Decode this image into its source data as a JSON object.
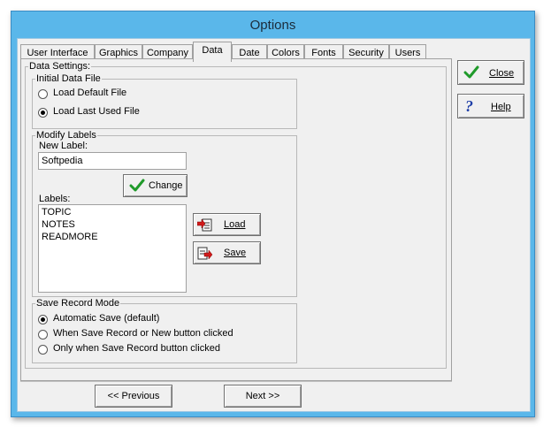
{
  "window": {
    "title": "Options"
  },
  "tabs": [
    {
      "label": "User Interface"
    },
    {
      "label": "Graphics"
    },
    {
      "label": "Company"
    },
    {
      "label": "Data",
      "active": true
    },
    {
      "label": "Date"
    },
    {
      "label": "Colors"
    },
    {
      "label": "Fonts"
    },
    {
      "label": "Security"
    },
    {
      "label": "Users"
    }
  ],
  "data_settings": {
    "label": "Data Settings:",
    "initial_file": {
      "label": "Initial Data File",
      "options": [
        {
          "label": "Load Default File",
          "selected": false
        },
        {
          "label": "Load Last Used File",
          "selected": true
        }
      ]
    },
    "modify_labels": {
      "label": "Modify Labels",
      "new_label_caption": "New Label:",
      "new_label_value": "Softpedia",
      "change_button": "Change",
      "labels_caption": "Labels:",
      "labels": [
        "TOPIC",
        "NOTES",
        "READMORE"
      ],
      "load_button": "Load",
      "save_button": "Save"
    },
    "save_mode": {
      "label": "Save Record Mode",
      "options": [
        {
          "label": "Automatic Save (default)",
          "selected": true
        },
        {
          "label": "When Save Record or New button clicked",
          "selected": false
        },
        {
          "label": "Only when Save Record button clicked",
          "selected": false
        }
      ]
    }
  },
  "side_buttons": {
    "close": "Close",
    "help": "Help"
  },
  "nav": {
    "previous": "<< Previous",
    "next": "Next >>"
  },
  "colors": {
    "title_bar": "#5ab7ea",
    "check_green": "#1f9a2a",
    "help_blue": "#1f3fa8",
    "arrow_red": "#d11a1a"
  }
}
